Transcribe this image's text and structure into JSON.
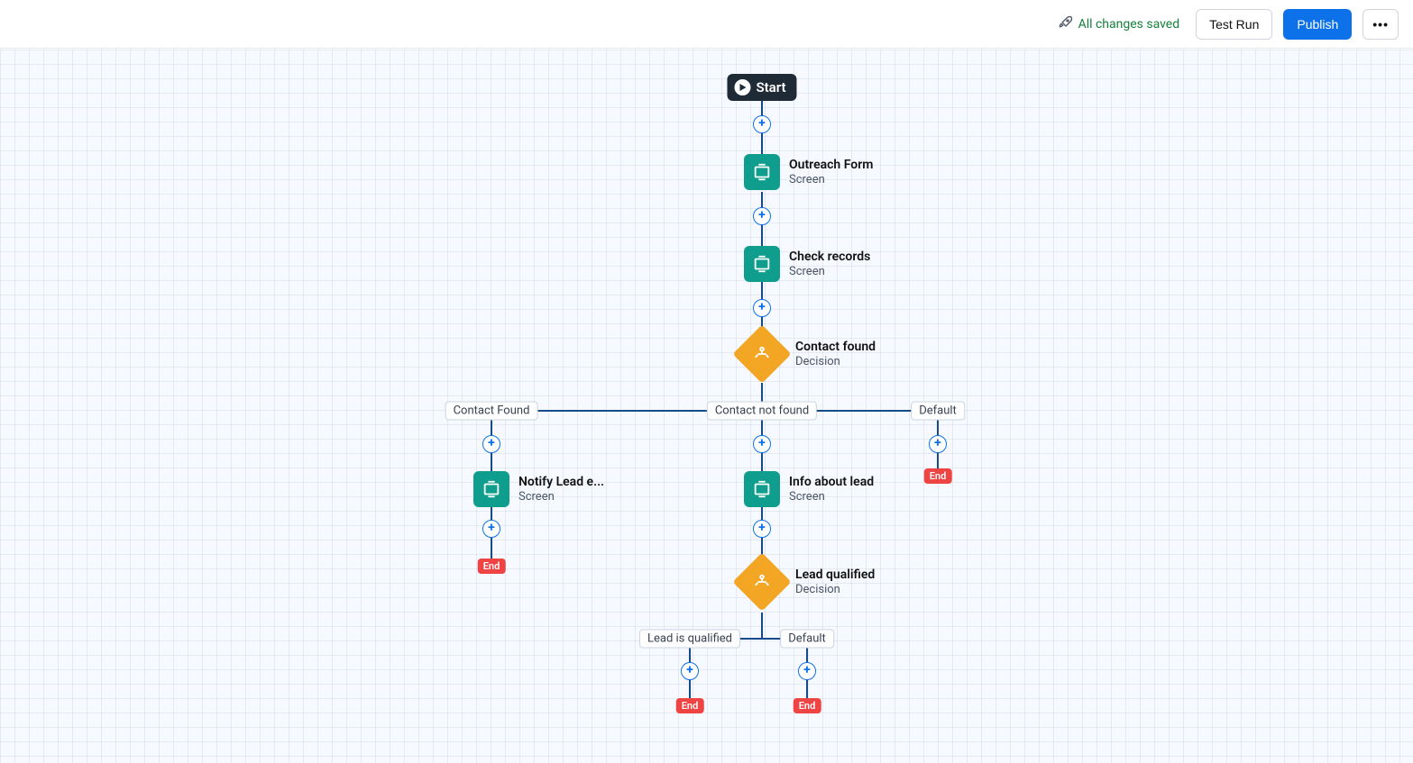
{
  "toolbar": {
    "save_status": "All changes saved",
    "test_run_label": "Test Run",
    "publish_label": "Publish",
    "more_label": "•••"
  },
  "flow": {
    "start_label": "Start",
    "nodes": {
      "outreach_form": {
        "title": "Outreach Form",
        "subtitle": "Screen"
      },
      "check_records": {
        "title": "Check records",
        "subtitle": "Screen"
      },
      "contact_found": {
        "title": "Contact found",
        "subtitle": "Decision"
      },
      "notify_lead": {
        "title": "Notify Lead e...",
        "subtitle": "Screen"
      },
      "info_lead": {
        "title": "Info about lead",
        "subtitle": "Screen"
      },
      "lead_qualified": {
        "title": "Lead qualified",
        "subtitle": "Decision"
      }
    },
    "branches": {
      "contact_found_yes": "Contact Found",
      "contact_not_found": "Contact not found",
      "contact_default": "Default",
      "lead_is_qualified": "Lead is qualified",
      "lead_default": "Default"
    },
    "end_label": "End"
  }
}
